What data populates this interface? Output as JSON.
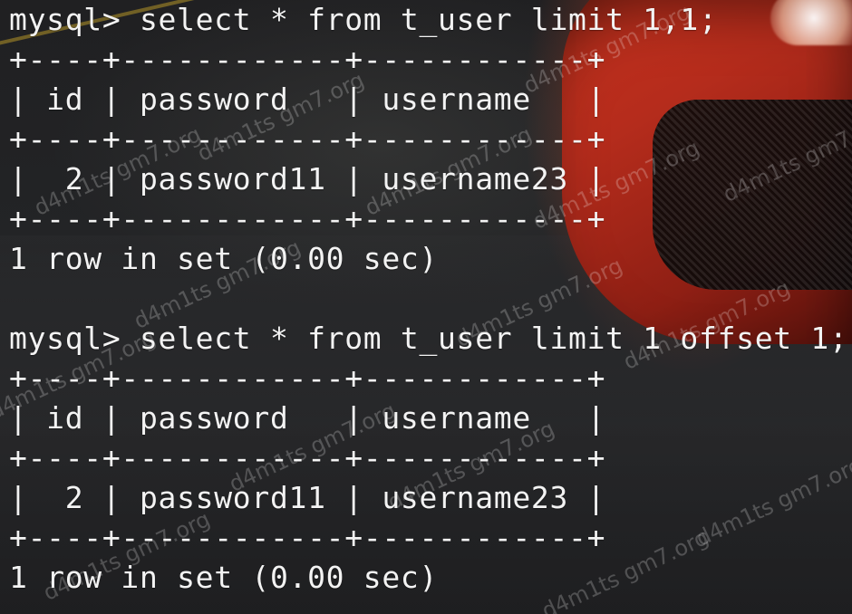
{
  "terminal": {
    "lines": [
      "mysql> select * from t_user limit 1,1;",
      "+----+------------+------------+",
      "| id | password   | username   |",
      "+----+------------+------------+",
      "|  2 | password11 | username23 |",
      "+----+------------+------------+",
      "1 row in set (0.00 sec)",
      "",
      "mysql> select * from t_user limit 1 offset 1;",
      "+----+------------+------------+",
      "| id | password   | username   |",
      "+----+------------+------------+",
      "|  2 | password11 | username23 |",
      "+----+------------+------------+",
      "1 row in set (0.00 sec)"
    ]
  },
  "watermark": {
    "text": "d4m1ts gm7.org"
  }
}
